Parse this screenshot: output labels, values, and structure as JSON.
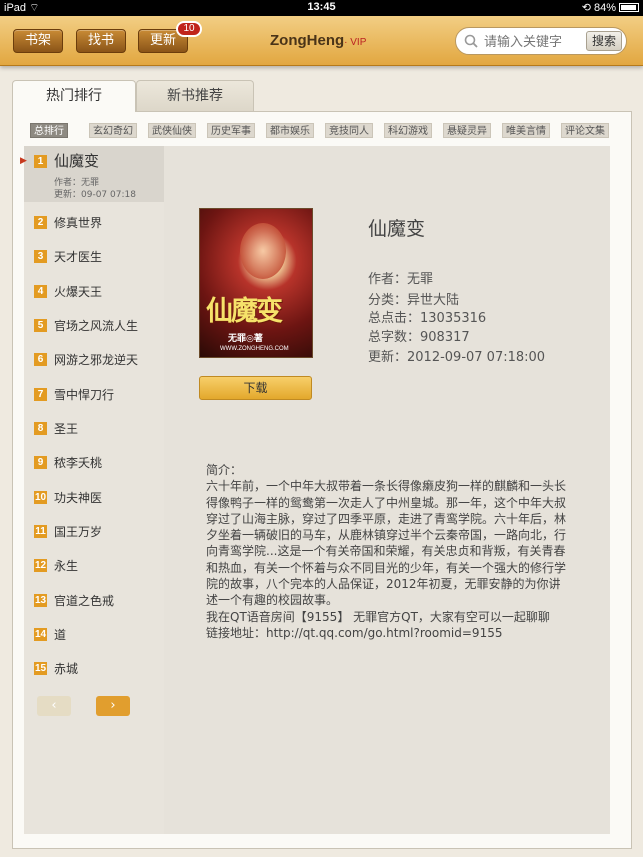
{
  "status_bar": {
    "device": "iPad",
    "time": "13:45",
    "battery": "84%",
    "battery_level": 0.84
  },
  "navbar": {
    "bookshelf": "书架",
    "find": "找书",
    "update": "更新",
    "update_badge": "10",
    "logo": "ZongHeng",
    "logo_vip": "· VIP",
    "search_placeholder": "请输入关键字",
    "search_button": "搜索"
  },
  "tabs": {
    "hot": "热门排行",
    "new": "新书推荐"
  },
  "categories": [
    "总排行",
    "玄幻奇幻",
    "武侠仙侠",
    "历史军事",
    "都市娱乐",
    "竞技同人",
    "科幻游戏",
    "悬疑灵异",
    "唯美言情",
    "评论文集"
  ],
  "ranking": [
    {
      "rank": "1",
      "title": "仙魔变",
      "author": "作者：无罪",
      "updated": "更新：09-07 07:18"
    },
    {
      "rank": "2",
      "title": "修真世界"
    },
    {
      "rank": "3",
      "title": "天才医生"
    },
    {
      "rank": "4",
      "title": "火爆天王"
    },
    {
      "rank": "5",
      "title": "官场之风流人生"
    },
    {
      "rank": "6",
      "title": "网游之邪龙逆天"
    },
    {
      "rank": "7",
      "title": "雪中悍刀行"
    },
    {
      "rank": "8",
      "title": "圣王"
    },
    {
      "rank": "9",
      "title": "秾李夭桃"
    },
    {
      "rank": "10",
      "title": "功夫神医"
    },
    {
      "rank": "11",
      "title": "国王万岁"
    },
    {
      "rank": "12",
      "title": "永生"
    },
    {
      "rank": "13",
      "title": "官道之色戒"
    },
    {
      "rank": "14",
      "title": "道"
    },
    {
      "rank": "15",
      "title": "赤城"
    }
  ],
  "pager": {
    "prev": "‹",
    "next": "›"
  },
  "book": {
    "title": "仙魔变",
    "cover_title": "仙魔变",
    "cover_author": "无罪◎著",
    "cover_site": "WWW.ZONGHENG.COM",
    "author": "作者：无罪",
    "category": "分类：异世大陆",
    "clicks": "总点击：13035316",
    "words": "总字数：908317",
    "updated": "更新：2012-09-07 07:18:00",
    "download": "下载",
    "summary_label": "简介：",
    "summary": "六十年前，一个中年大叔带着一条长得像癞皮狗一样的麒麟和一头长得像鸭子一样的鸳鸯第一次走人了中州皇城。那一年，这个中年大叔穿过了山海主脉，穿过了四季平原，走进了青鸾学院。六十年后，林夕坐着一辆破旧的马车，从鹿林镇穿过半个云秦帝国，一路向北，行向青鸾学院...这是一个有关帝国和荣耀，有关忠贞和背叛，有关青春和热血，有关一个怀着与众不同目光的少年，有关一个强大的修行学院的故事，八个完本的人品保证，2012年初夏，无罪安静的为你讲述一个有趣的校园故事。",
    "summary_extra_1": "我在QT语音房间【9155】 无罪官方QT，大家有空可以一起聊聊",
    "summary_extra_2": "链接地址：http://qt.qq.com/go.html?roomid=9155"
  }
}
